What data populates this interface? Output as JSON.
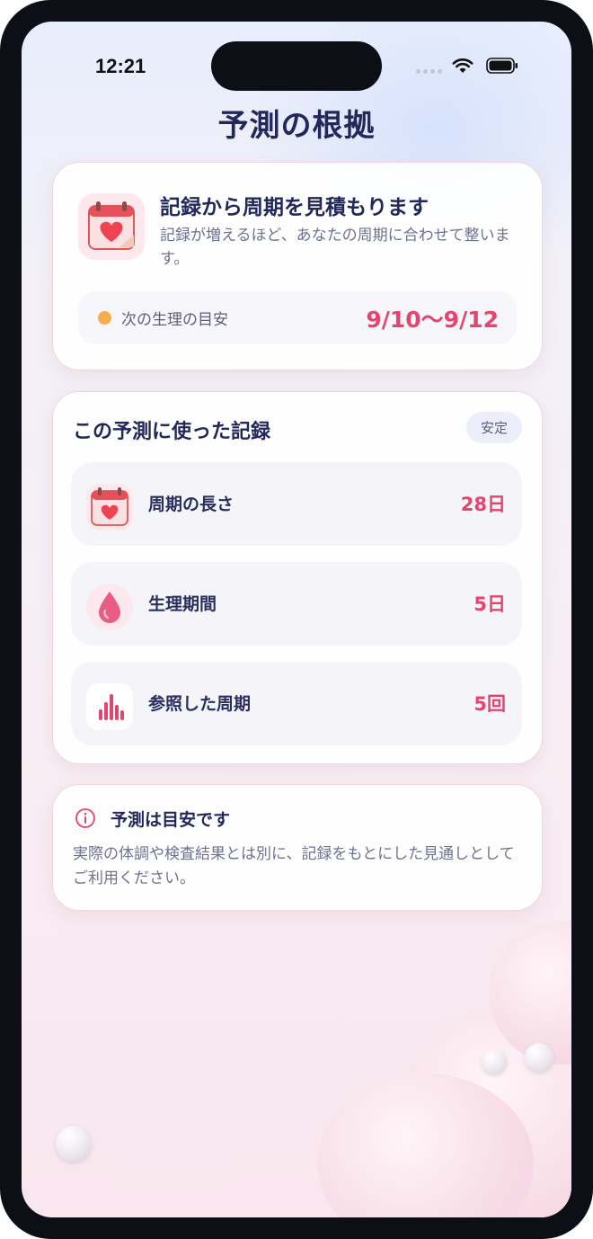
{
  "status_bar": {
    "time": "12:21"
  },
  "page": {
    "title": "予測の根拠"
  },
  "summary": {
    "title": "記録から周期を見積もります",
    "description": "記録が増えるほど、あなたの周期に合わせて整います。",
    "next_period_label": "次の生理の目安",
    "next_period_range": "9/10〜9/12"
  },
  "records": {
    "title": "この予測に使った記録",
    "status_badge": "安定",
    "items": [
      {
        "label": "周期の長さ",
        "value": "28日",
        "icon": "calendar-heart-icon"
      },
      {
        "label": "生理期間",
        "value": "5日",
        "icon": "drop-icon"
      },
      {
        "label": "参照した周期",
        "value": "5回",
        "icon": "bar-chart-icon"
      }
    ]
  },
  "notice": {
    "title": "予測は目安です",
    "text": "実際の体調や検査結果とは別に、記録をもとにした見通しとしてご利用ください。"
  },
  "colors": {
    "accent": "#e5456c",
    "title": "#22285a",
    "dot": "#f6ac48"
  }
}
